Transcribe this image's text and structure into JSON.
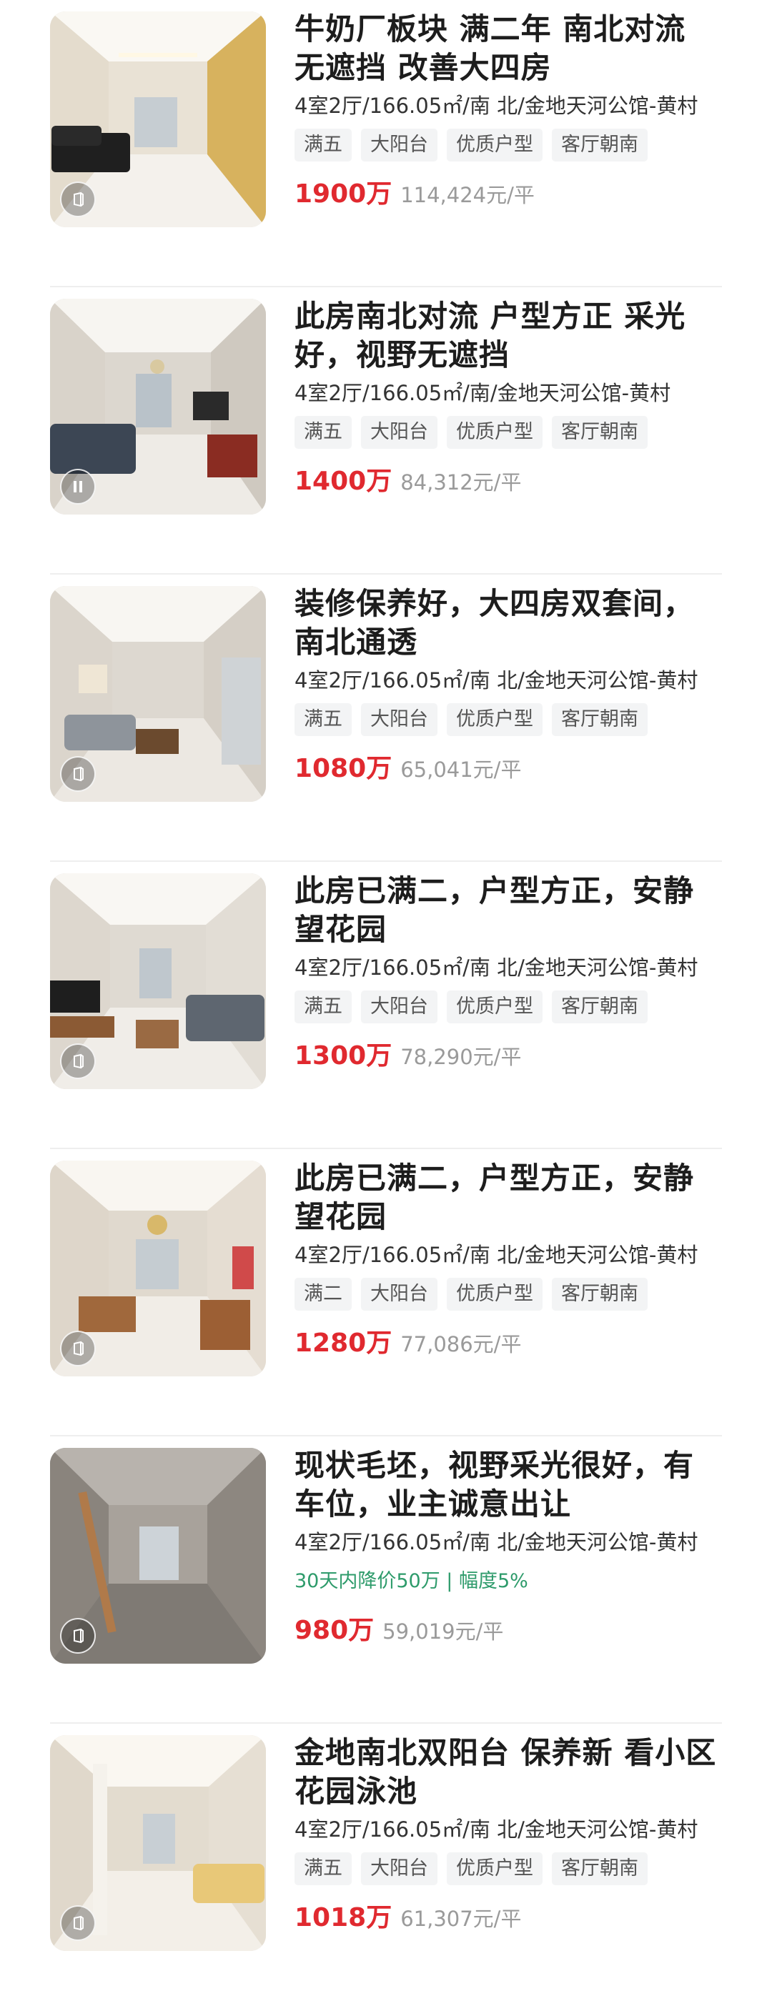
{
  "listings": [
    {
      "title": "牛奶厂板块 满二年 南北对流 无遮挡 改善大四房",
      "meta": "4室2厅/166.05㎡/南 北/金地天河公馆-黄村",
      "tags": [
        "满五",
        "大阳台",
        "优质户型",
        "客厅朝南"
      ],
      "price": "1900万",
      "unit_price": "114,424元/平",
      "photo": "bright-living-room",
      "badge_icon": "vr-icon"
    },
    {
      "title": "此房南北对流 户型方正 采光好，视野无遮挡",
      "meta": "4室2厅/166.05㎡/南/金地天河公馆-黄村",
      "tags": [
        "满五",
        "大阳台",
        "优质户型",
        "客厅朝南"
      ],
      "price": "1400万",
      "unit_price": "84,312元/平",
      "photo": "living-room-grey-sofa",
      "badge_icon": "video-icon"
    },
    {
      "title": "装修保养好，大四房双套间，南北通透",
      "meta": "4室2厅/166.05㎡/南 北/金地天河公馆-黄村",
      "tags": [
        "满五",
        "大阳台",
        "优质户型",
        "客厅朝南"
      ],
      "price": "1080万",
      "unit_price": "65,041元/平",
      "photo": "living-room-fridge",
      "badge_icon": "vr-icon"
    },
    {
      "title": "此房已满二，户型方正，安静望花园",
      "meta": "4室2厅/166.05㎡/南 北/金地天河公馆-黄村",
      "tags": [
        "满五",
        "大阳台",
        "优质户型",
        "客厅朝南"
      ],
      "price": "1300万",
      "unit_price": "78,290元/平",
      "photo": "living-room-tv",
      "badge_icon": "vr-icon"
    },
    {
      "title": "此房已满二，户型方正，安静望花园",
      "meta": "4室2厅/166.05㎡/南 北/金地天河公馆-黄村",
      "tags": [
        "满二",
        "大阳台",
        "优质户型",
        "客厅朝南"
      ],
      "price": "1280万",
      "unit_price": "77,086元/平",
      "photo": "living-room-chandelier",
      "badge_icon": "vr-icon"
    },
    {
      "title": "现状毛坯，视野采光很好，有车位，业主诚意出让",
      "meta": "4室2厅/166.05㎡/南 北/金地天河公馆-黄村",
      "tags": [],
      "drop_notice": "30天内降价50万 | 幅度5%",
      "price": "980万",
      "unit_price": "59,019元/平",
      "photo": "unfinished-concrete-room",
      "badge_icon": "vr-icon"
    },
    {
      "title": "金地南北双阳台 保养新 看小区花园泳池",
      "meta": "4室2厅/166.05㎡/南 北/金地天河公馆-黄村",
      "tags": [
        "满五",
        "大阳台",
        "优质户型",
        "客厅朝南"
      ],
      "price": "1018万",
      "unit_price": "61,307元/平",
      "photo": "living-room-yellow-sofa",
      "badge_icon": "vr-icon"
    }
  ],
  "colors": {
    "price": "#e0292f",
    "drop_notice": "#2e9b6b",
    "tag_bg": "#f3f4f5"
  }
}
